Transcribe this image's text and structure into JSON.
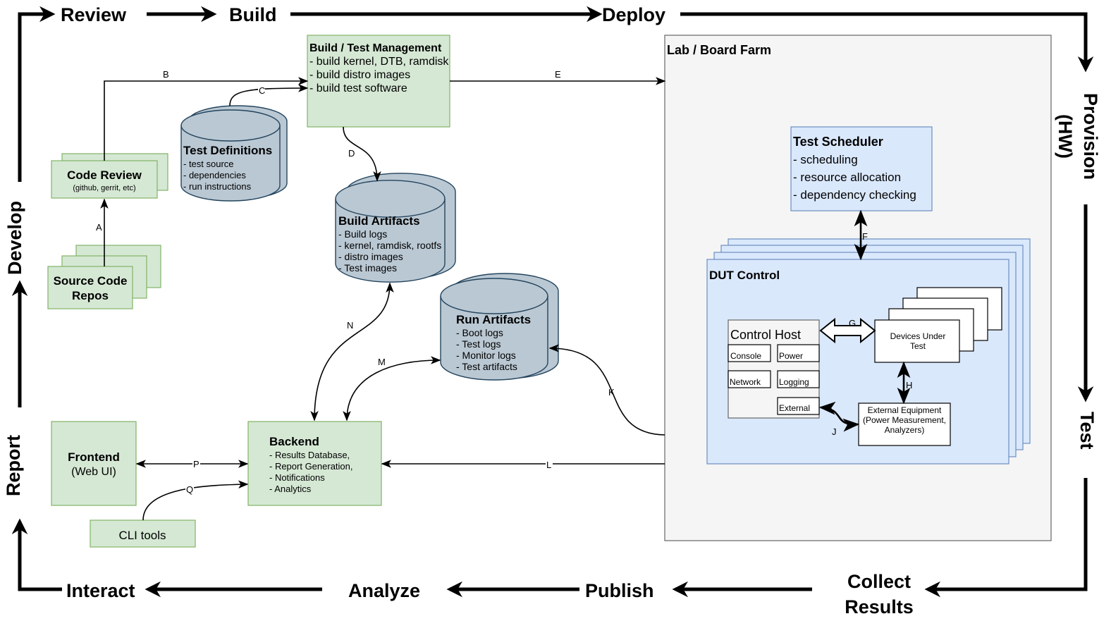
{
  "cycle": {
    "review": "Review",
    "build": "Build",
    "deploy": "Deploy",
    "provision": "Provision",
    "provision_sub": "(HW)",
    "test": "Test",
    "collect1": "Collect",
    "collect2": "Results",
    "publish": "Publish",
    "analyze": "Analyze",
    "interact": "Interact",
    "report": "Report",
    "develop": "Develop"
  },
  "build_mgmt": {
    "title": "Build / Test Management",
    "items": [
      "- build kernel, DTB, ramdisk",
      "- build distro images",
      "- build test software"
    ]
  },
  "lab": {
    "title": "Lab / Board Farm"
  },
  "scheduler": {
    "title": "Test Scheduler",
    "items": [
      "- scheduling",
      "- resource allocation",
      "- dependency checking"
    ]
  },
  "dut_control": {
    "title": "DUT Control"
  },
  "control_host": {
    "title": "Control Host",
    "console": "Console",
    "power": "Power",
    "network": "Network",
    "logging": "Logging",
    "external": "External"
  },
  "dut": {
    "line1": "Devices Under",
    "line2": "Test"
  },
  "ext_equipment": {
    "lines": [
      "External Equipment",
      "(Power Measurement,",
      "Analyzers)"
    ]
  },
  "code_review": {
    "title": "Code Review",
    "sub": "(github, gerrit, etc)"
  },
  "source_repos": {
    "line1": "Source Code",
    "line2": "Repos"
  },
  "test_defs": {
    "title": "Test Definitions",
    "items": [
      "- test source",
      "- dependencies",
      "- run instructions"
    ]
  },
  "build_artifacts": {
    "title": "Build Artifacts",
    "items": [
      "- Build logs",
      "- kernel, ramdisk, rootfs",
      "- distro images",
      "- Test images"
    ]
  },
  "run_artifacts": {
    "title": "Run Artifacts",
    "items": [
      "- Boot logs",
      "- Test logs",
      "- Monitor logs",
      "- Test artifacts"
    ]
  },
  "frontend": {
    "title": "Frontend",
    "sub": "(Web UI)"
  },
  "backend": {
    "title": "Backend",
    "items": [
      "- Results Database,",
      "- Report Generation,",
      "- Notifications",
      "- Analytics"
    ]
  },
  "cli": {
    "title": "CLI tools"
  },
  "edges": {
    "A": "A",
    "B": "B",
    "C": "C",
    "D": "D",
    "E": "E",
    "F": "F",
    "G": "G",
    "H": "H",
    "J": "J",
    "K": "K",
    "L": "L",
    "M": "M",
    "N": "N",
    "P": "P",
    "Q": "Q"
  }
}
